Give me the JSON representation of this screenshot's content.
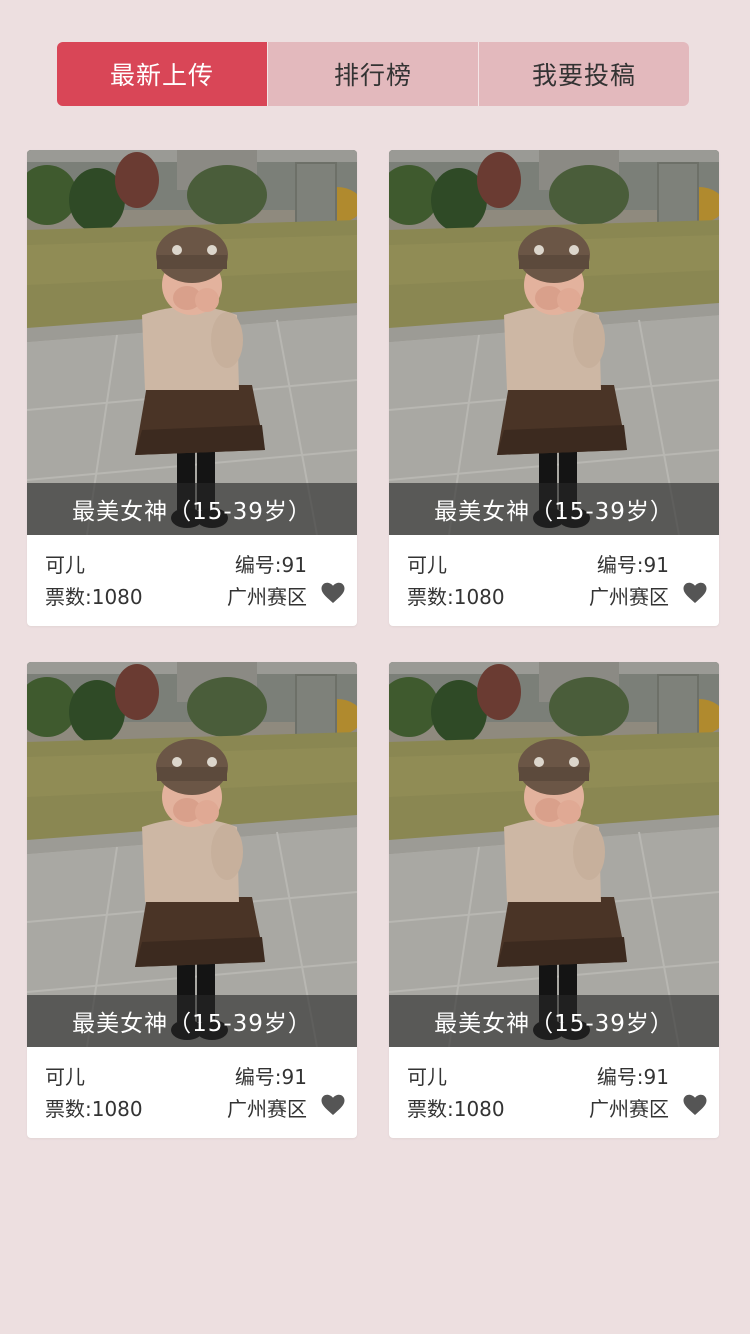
{
  "tabs": [
    {
      "label": "最新上传",
      "active": true
    },
    {
      "label": "排行榜",
      "active": false
    },
    {
      "label": "我要投稿",
      "active": false
    }
  ],
  "colors": {
    "accent": "#d94657",
    "tab_inactive": "#e3b9bd",
    "background": "#eddfe0"
  },
  "entries": [
    {
      "caption": "最美女神（15-39岁）",
      "name": "可儿",
      "number": "编号:91",
      "votes": "票数:1080",
      "region": "广州赛区",
      "like_icon": "heart-icon"
    },
    {
      "caption": "最美女神（15-39岁）",
      "name": "可儿",
      "number": "编号:91",
      "votes": "票数:1080",
      "region": "广州赛区",
      "like_icon": "heart-icon"
    },
    {
      "caption": "最美女神（15-39岁）",
      "name": "可儿",
      "number": "编号:91",
      "votes": "票数:1080",
      "region": "广州赛区",
      "like_icon": "heart-icon"
    },
    {
      "caption": "最美女神（15-39岁）",
      "name": "可儿",
      "number": "编号:91",
      "votes": "票数:1080",
      "region": "广州赛区",
      "like_icon": "heart-icon"
    }
  ]
}
